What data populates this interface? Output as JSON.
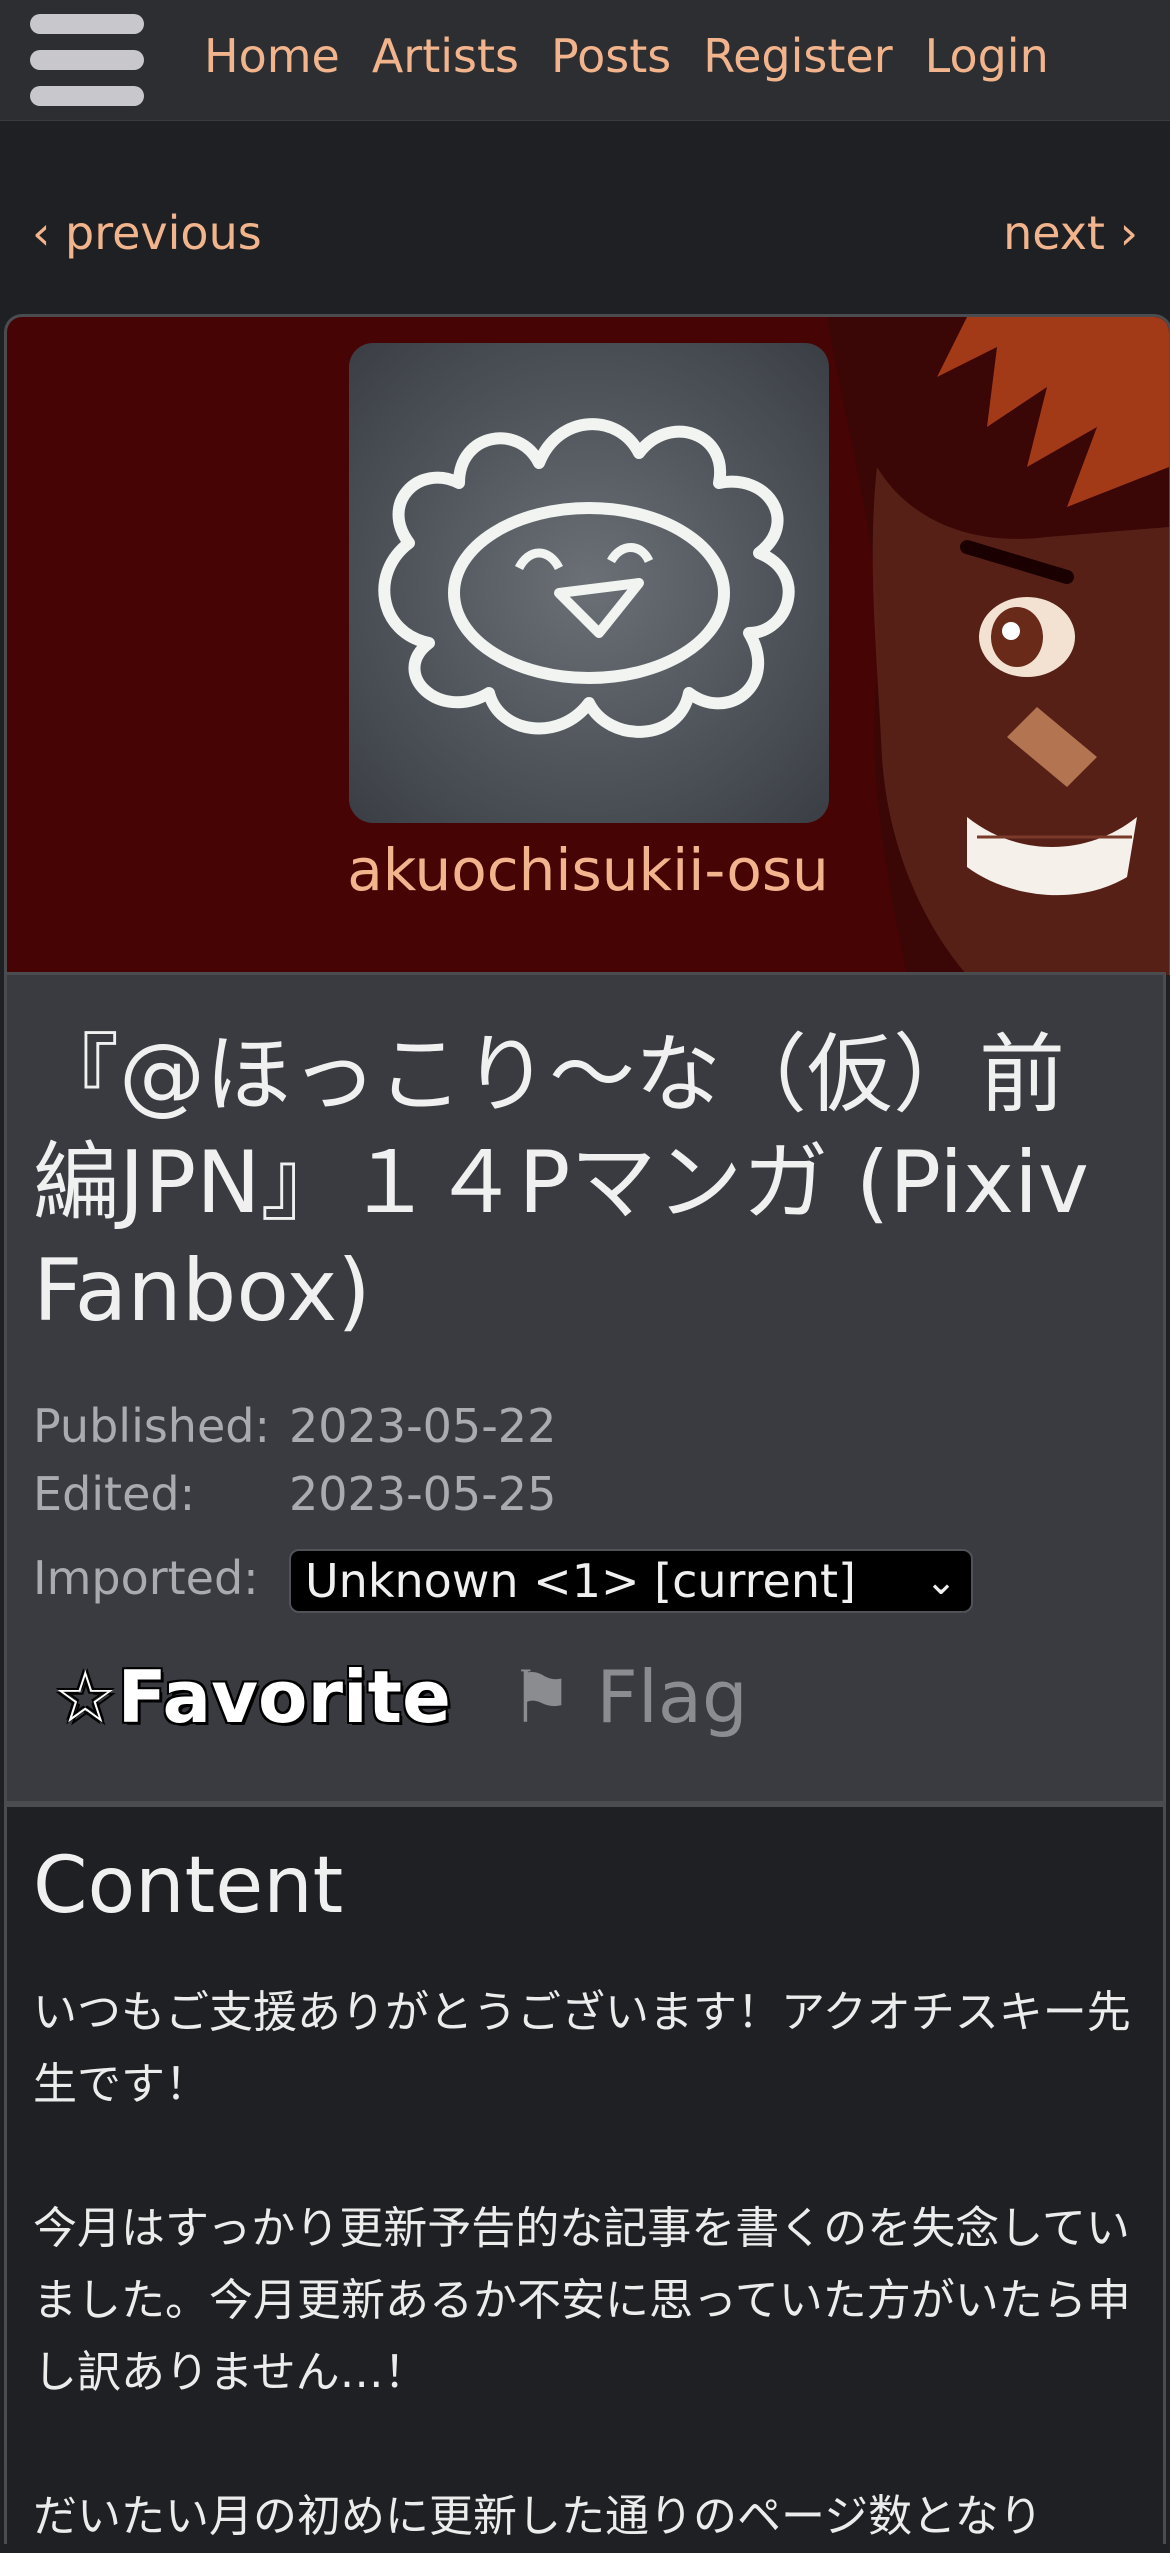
{
  "nav": {
    "links": [
      "Home",
      "Artists",
      "Posts",
      "Register",
      "Login"
    ]
  },
  "pager": {
    "previous": "‹ previous",
    "next": "next ›"
  },
  "artist": {
    "name": "akuochisukii-osu"
  },
  "post": {
    "title": "『@ほっこり～な（仮）前編JPN』１４Pマンガ (Pixiv Fanbox)",
    "published_label": "Published:",
    "published_value": "2023-05-22",
    "edited_label": "Edited:",
    "edited_value": "2023-05-25",
    "imported_label": "Imported:",
    "imported_value": "Unknown <1> [current]",
    "favorite_label": "☆Favorite",
    "flag_label": "⚑ Flag"
  },
  "content": {
    "heading": "Content",
    "paragraphs": [
      "いつもご支援ありがとうございます！アクオチスキー先生です！",
      "今月はすっかり更新予告的な記事を書くのを失念していました。今月更新あるか不安に思っていた方がいたら申し訳ありません…！",
      "だいたい月の初めに更新した通りのページ数となり"
    ]
  },
  "icons": {
    "menu": "hamburger-menu-icon",
    "chevron": "chevron-down-icon"
  },
  "colors": {
    "link": "#f2b48c",
    "banner_bg": "#470404",
    "info_bg": "#393b40",
    "page_bg": "#1f2023"
  }
}
